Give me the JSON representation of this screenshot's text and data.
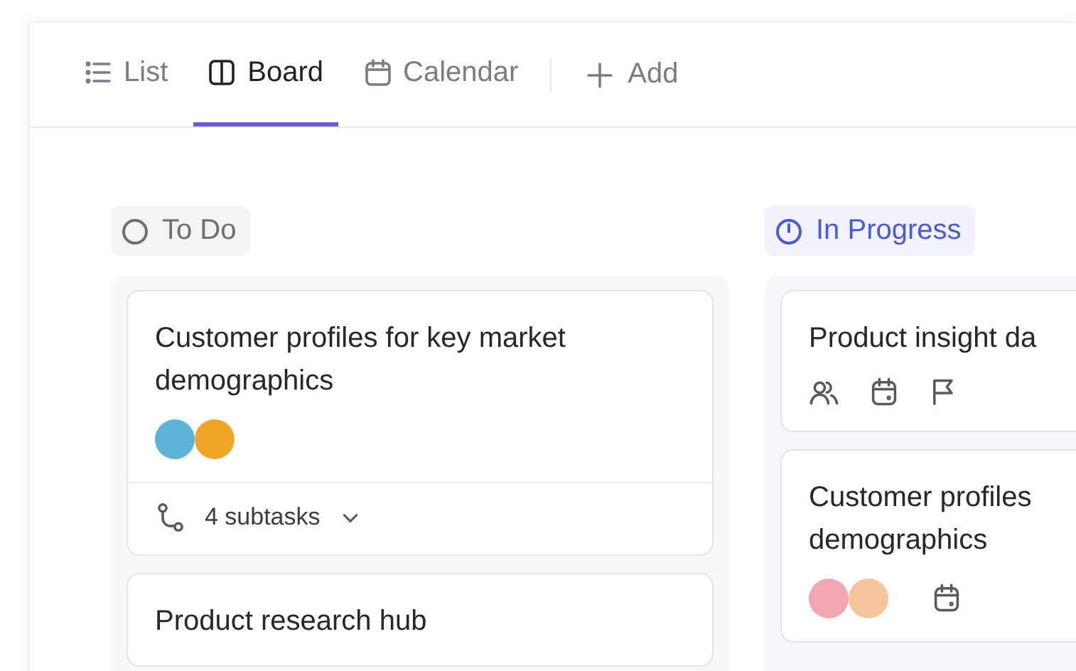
{
  "tabs": [
    {
      "label": "List",
      "kind": "list",
      "selected": false
    },
    {
      "label": "Board",
      "kind": "board",
      "selected": true
    },
    {
      "label": "Calendar",
      "kind": "calendar",
      "selected": false
    }
  ],
  "add_button": {
    "label": "Add"
  },
  "columns": [
    {
      "name": "To Do",
      "kind": "open",
      "color": "#6b6f76",
      "cards": [
        {
          "title_lines": [
            "Customer profiles for key market",
            "demographics"
          ],
          "assignees": [
            {
              "kind": "photo"
            },
            {
              "kind": "photo"
            }
          ],
          "subtasks": {
            "label": "4 subtasks",
            "expanded": false
          }
        },
        {
          "title_lines": [
            "Product research hub"
          ]
        }
      ]
    },
    {
      "name": "In Progress",
      "kind": "in_progress",
      "color": "#4a5bd4",
      "cards": [
        {
          "title_lines": [
            "Product insight da"
          ],
          "fields": [
            {
              "kind": "assignee"
            },
            {
              "kind": "date"
            },
            {
              "kind": "priority"
            }
          ]
        },
        {
          "title_lines": [
            "Customer profiles",
            "demographics"
          ],
          "assignees": [
            {
              "kind": "photo"
            },
            {
              "kind": "photo"
            }
          ],
          "fields": [
            {
              "kind": "date"
            }
          ]
        }
      ]
    }
  ]
}
